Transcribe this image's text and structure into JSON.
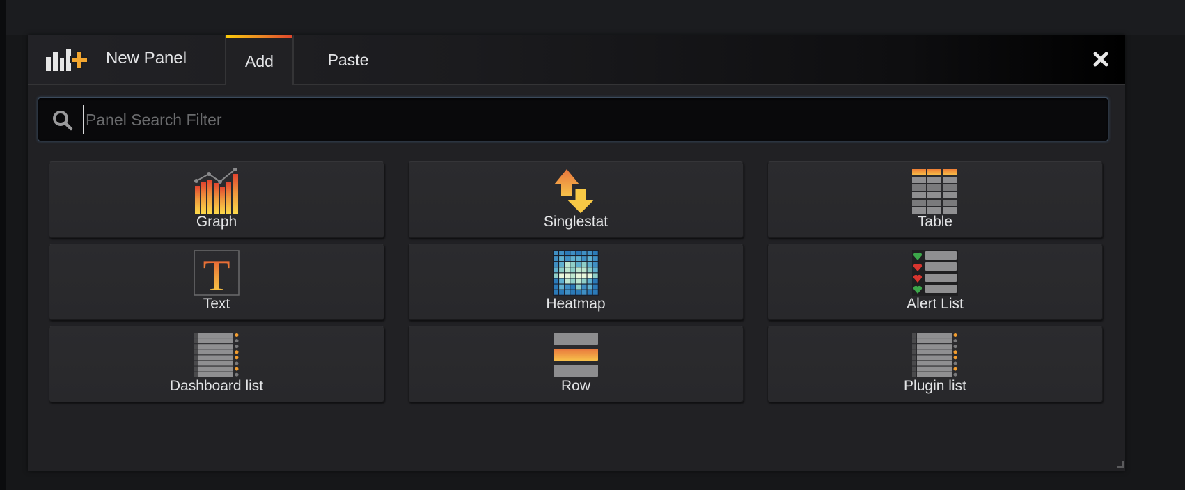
{
  "header": {
    "title": "New Panel",
    "icon": "add-panel-icon",
    "tabs": [
      {
        "label": "Add",
        "active": true
      },
      {
        "label": "Paste",
        "active": false
      }
    ],
    "close_icon": "close-icon"
  },
  "search": {
    "placeholder": "Panel Search Filter",
    "value": "",
    "icon": "search-icon"
  },
  "panels": [
    {
      "label": "Graph",
      "icon": "graph-icon"
    },
    {
      "label": "Singlestat",
      "icon": "singlestat-icon"
    },
    {
      "label": "Table",
      "icon": "table-icon"
    },
    {
      "label": "Text",
      "icon": "text-icon"
    },
    {
      "label": "Heatmap",
      "icon": "heatmap-icon"
    },
    {
      "label": "Alert List",
      "icon": "alert-list-icon"
    },
    {
      "label": "Dashboard list",
      "icon": "dashboard-list-icon"
    },
    {
      "label": "Row",
      "icon": "row-icon"
    },
    {
      "label": "Plugin list",
      "icon": "plugin-list-icon"
    }
  ],
  "colors": {
    "accent_start": "#fbca0a",
    "accent_end": "#e0452c",
    "background": "#212124"
  }
}
